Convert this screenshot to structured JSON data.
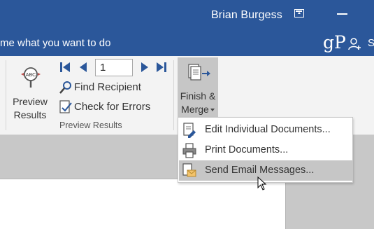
{
  "titlebar": {
    "user_name": "Brian Burgess",
    "colors": {
      "accent": "#2b579a"
    }
  },
  "tellbar": {
    "tell_me_text": "me what you want to do",
    "logo_text": "gP",
    "share_label": "S"
  },
  "ribbon": {
    "preview_results": {
      "label_line1": "Preview",
      "label_line2": "Results",
      "icon": "abc-magnifier-icon"
    },
    "record_field": {
      "value": "1"
    },
    "find_recipient": {
      "label": "Find Recipient",
      "icon": "find-recipient-icon"
    },
    "check_errors": {
      "label": "Check for Errors",
      "icon": "check-errors-icon"
    },
    "group_label": "Preview Results",
    "finish_merge": {
      "label_line1": "Finish &",
      "label_line2": "Merge",
      "icon": "finish-merge-icon"
    }
  },
  "menu": {
    "items": [
      {
        "label": "Edit Individual Documents...",
        "icon": "edit-documents-icon"
      },
      {
        "label": "Print Documents...",
        "icon": "printer-icon"
      },
      {
        "label": "Send Email Messages...",
        "icon": "email-icon",
        "highlighted": true
      }
    ]
  }
}
